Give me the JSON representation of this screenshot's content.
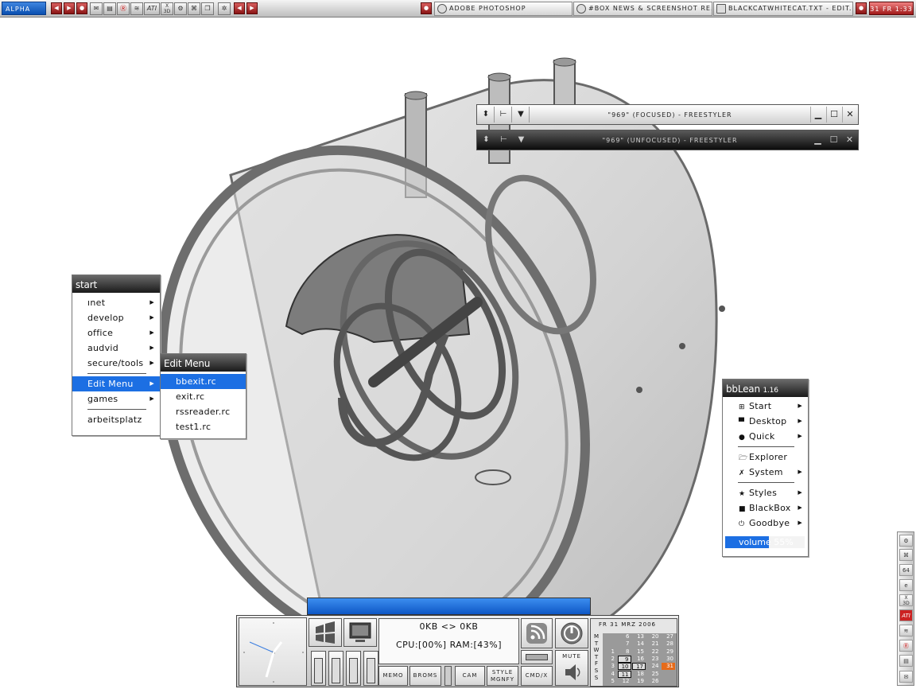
{
  "toolbar": {
    "workspace": "ALPHA",
    "tray_icons": [
      "mail-icon",
      "save-icon",
      "avira-icon",
      "chart-icon",
      "ati-icon",
      "xgl-3d-icon",
      "settings-icon",
      "network-icon",
      "windows-icon",
      "gear-icon"
    ],
    "ati_label": "ATI",
    "tasks": [
      {
        "label": "ADOBE PHOTOSHOP"
      },
      {
        "label": "#BOX NEWS & SCREENSHOT RE..."
      },
      {
        "label": "BLACKCATWHITECAT.TXT - EDIT..."
      }
    ],
    "clock": "31 FR 1:33"
  },
  "freestyler": {
    "focused_title": "\"969\" (FOCUSED) - FREESTYLER",
    "unfocused_title": "\"969\" (UNFOCUSED) - FREESTYLER"
  },
  "start_menu": {
    "title": "start",
    "items": [
      {
        "label": "ınet"
      },
      {
        "label": "develop"
      },
      {
        "label": "office"
      },
      {
        "label": "audvid"
      },
      {
        "label": "secure/tools"
      },
      {
        "label": "Edit Menu"
      },
      {
        "label": "games"
      },
      {
        "label": "arbeitsplatz"
      }
    ]
  },
  "edit_menu": {
    "title": "Edit Menu",
    "items": [
      {
        "label": "bbexit.rc"
      },
      {
        "label": "exit.rc"
      },
      {
        "label": "rssreader.rc"
      },
      {
        "label": "test1.rc"
      }
    ]
  },
  "bb_menu": {
    "title": "bbLean",
    "version": "1.16",
    "items": [
      {
        "label": "Start"
      },
      {
        "label": "Desktop"
      },
      {
        "label": "Quick"
      },
      {
        "label": "Explorer"
      },
      {
        "label": "System"
      },
      {
        "label": "Styles"
      },
      {
        "label": "BlackBox"
      },
      {
        "label": "Goodbye"
      }
    ],
    "volume_label": "volume 55%",
    "volume_level": 0.55
  },
  "slit": {
    "mem_line": "0KB <> 0KB",
    "cpu_line": "CPU:[00%] RAM:[43%]",
    "buttons": [
      "MEMO",
      "BROMS",
      "CAM",
      "STYLE MGNFY",
      "CMD/X"
    ],
    "mute": "MUTE",
    "calendar": {
      "header": "FR 31 MRZ  2006",
      "day_letters": [
        "M",
        "T",
        "W",
        "T",
        "F",
        "S",
        "S"
      ],
      "weeks": [
        [
          "",
          "",
          "1",
          "2",
          "3",
          "4",
          "5"
        ],
        [
          "6",
          "7",
          "8",
          "9",
          "10",
          "11",
          "12"
        ],
        [
          "13",
          "14",
          "15",
          "16",
          "17",
          "18",
          "19"
        ],
        [
          "20",
          "21",
          "22",
          "23",
          "24",
          "25",
          "26"
        ],
        [
          "27",
          "28",
          "29",
          "30",
          "31",
          "",
          ""
        ]
      ]
    }
  },
  "right_dock": {
    "icons": [
      "gear-icon",
      "network-icon",
      "64-icon",
      "ie-icon",
      "xgl-3d-icon",
      "ati-icon",
      "chart-icon",
      "avira-icon",
      "save-icon",
      "mail-icon"
    ]
  },
  "colors": {
    "accent_blue": "#1c6fe3",
    "toolbar_red": "#a01818",
    "today_orange": "#e66b1a"
  }
}
